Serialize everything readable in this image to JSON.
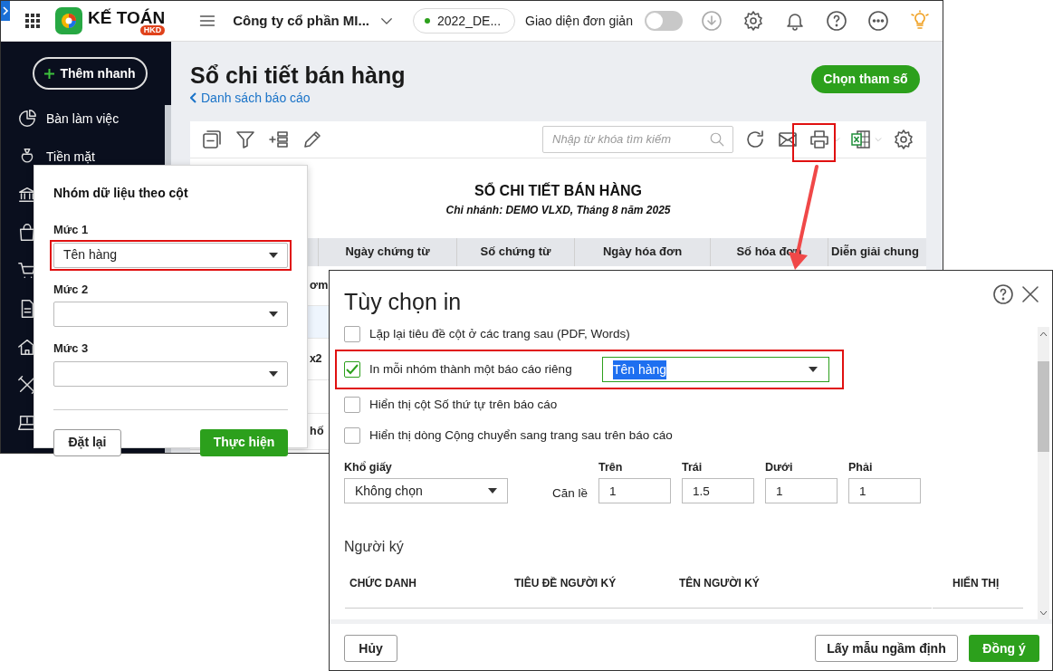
{
  "topbar": {
    "app_name": "KẾ TOÁN",
    "app_badge": "HKD",
    "company": "Công ty cổ phần MI...",
    "year_chip": "2022_DE...",
    "simple_mode_label": "Giao diện đơn giản",
    "simple_mode_on": false
  },
  "sidebar": {
    "quick_add": "Thêm nhanh",
    "items": [
      {
        "label": "Bàn làm việc"
      },
      {
        "label": "Tiền mặt"
      }
    ]
  },
  "page": {
    "title": "Sổ chi tiết bán hàng",
    "back_link": "Danh sách báo cáo",
    "params_button": "Chọn tham số"
  },
  "toolbar": {
    "search_placeholder": "Nhập từ khóa tìm kiếm",
    "print_highlighted": true
  },
  "report": {
    "title": "SỔ CHI TIẾT BÁN HÀNG",
    "subtitle": "Chi nhánh: DEMO VLXD, Tháng 8 năm 2025",
    "columns": [
      "Ngày chứng từ",
      "Số chứng từ",
      "Ngày hóa đơn",
      "Số hóa đơn",
      "Diễn giải chung"
    ],
    "rows": [
      {
        "fragment": "ơ m",
        "selected": false
      },
      {
        "selected": true
      },
      {
        "fragment": "x2",
        "selected": false
      },
      {
        "selected": false
      },
      {
        "fragment": "h ố",
        "selected": false
      }
    ]
  },
  "grouping_popup": {
    "title": "Nhóm dữ liệu theo cột",
    "levels": [
      {
        "label": "Mức 1",
        "value": "Tên hàng",
        "highlighted": true
      },
      {
        "label": "Mức 2",
        "highlighted": false
      },
      {
        "label": "Mức 3",
        "highlighted": false
      }
    ],
    "reset_button": "Đặt lại",
    "apply_button": "Thực hiện"
  },
  "print_dialog": {
    "title": "Tùy chọn in",
    "options": [
      {
        "label": "Lặp lại tiêu đề cột ở các trang sau (PDF, Words)",
        "checked": false
      },
      {
        "label": "In mỗi nhóm thành một báo cáo riêng",
        "checked": true,
        "group_select": "Tên hàng",
        "highlighted": true
      },
      {
        "label": "Hiển thị cột Số thứ tự trên báo cáo",
        "checked": false
      },
      {
        "label": "Hiển thị dòng Cộng chuyển sang trang sau trên báo cáo",
        "checked": false
      }
    ],
    "paper": {
      "label": "Khổ giấy",
      "value": "Không chọn"
    },
    "margin_label": "Căn lề",
    "margins": [
      {
        "label": "Trên",
        "value": "1"
      },
      {
        "label": "Trái",
        "value": "1.5"
      },
      {
        "label": "Dưới",
        "value": "1"
      },
      {
        "label": "Phải",
        "value": "1"
      }
    ],
    "signers_title": "Người ký",
    "signer_columns": [
      "CHỨC DANH",
      "TIÊU ĐỀ NGƯỜI KÝ",
      "TÊN NGƯỜI KÝ",
      "HIỂN THỊ"
    ],
    "cancel_button": "Hủy",
    "default_button": "Lấy mẫu ngầm định",
    "ok_button": "Đồng ý"
  }
}
